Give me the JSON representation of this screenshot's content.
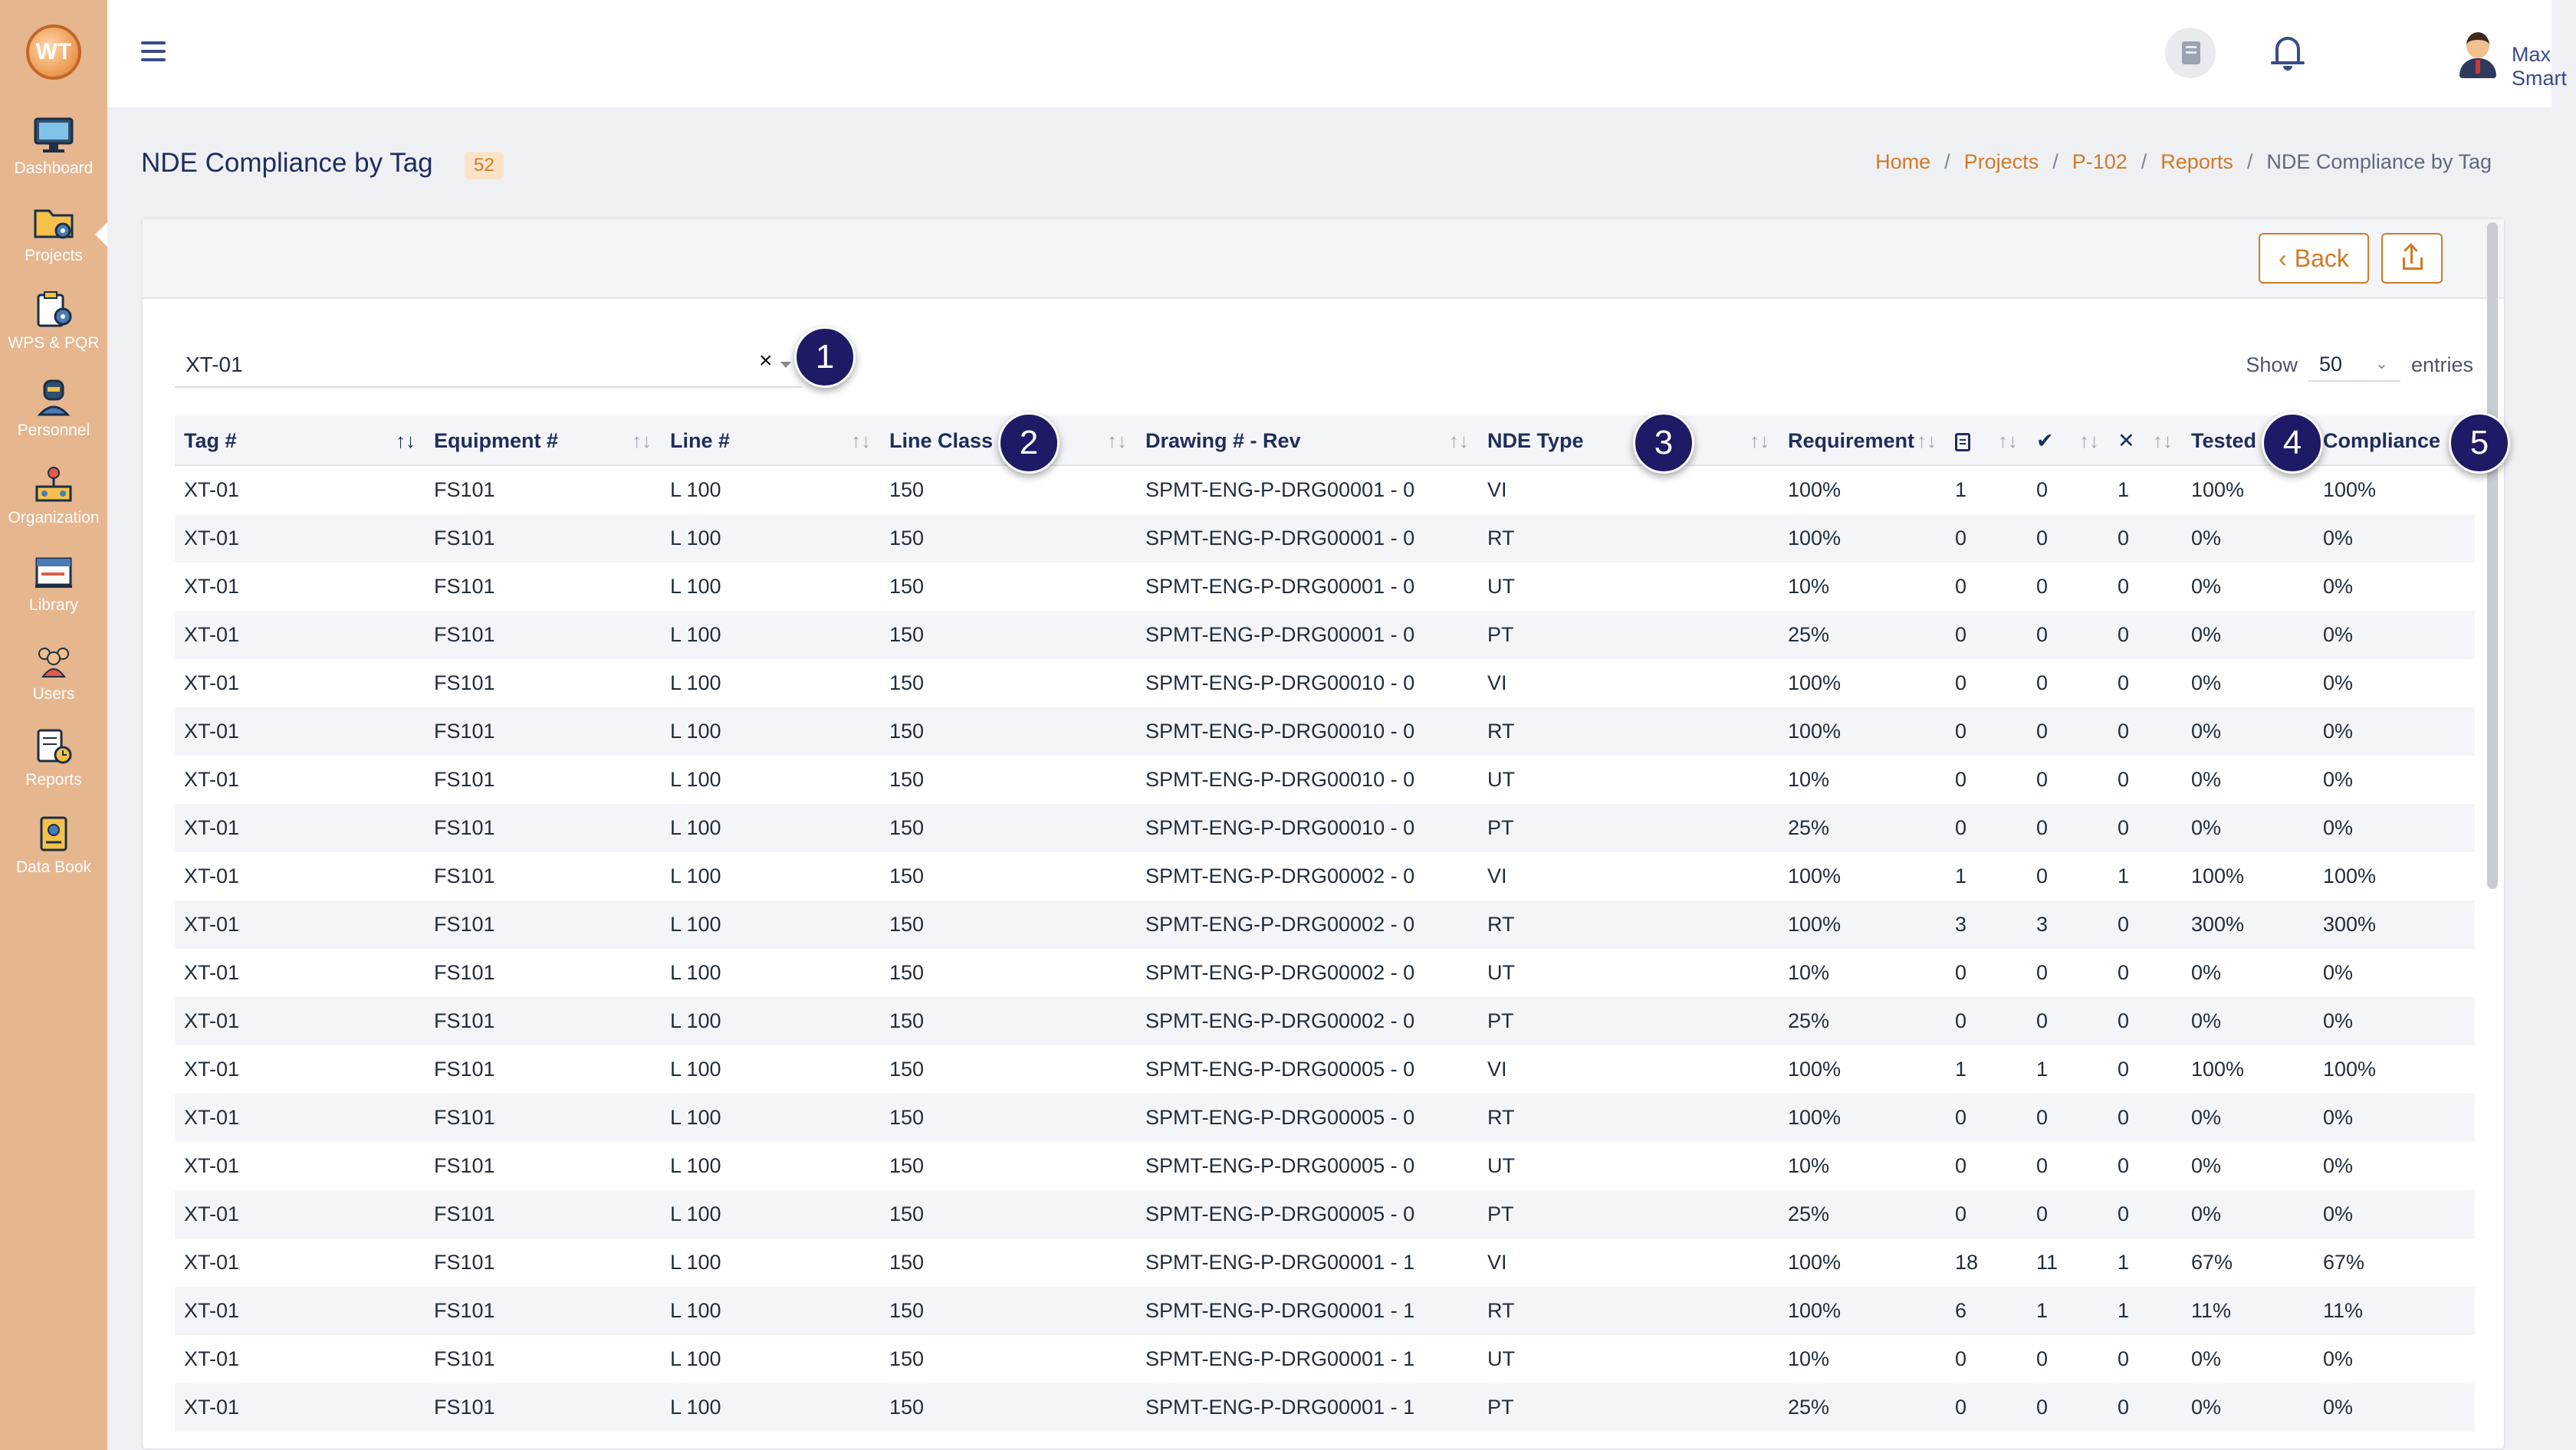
{
  "sidebar": {
    "logo_text": "WT",
    "items": [
      {
        "label": "Dashboard",
        "icon": "monitor-icon"
      },
      {
        "label": "Projects",
        "icon": "folder-gear-icon"
      },
      {
        "label": "WPS & PQR",
        "icon": "clipboard-gear-icon"
      },
      {
        "label": "Personnel",
        "icon": "welder-icon"
      },
      {
        "label": "Organization",
        "icon": "org-chart-icon"
      },
      {
        "label": "Library",
        "icon": "books-icon"
      },
      {
        "label": "Users",
        "icon": "users-icon"
      },
      {
        "label": "Reports",
        "icon": "report-clock-icon"
      },
      {
        "label": "Data Book",
        "icon": "data-book-icon"
      }
    ]
  },
  "header": {
    "user_name": "Max Smart"
  },
  "page": {
    "title": "NDE Compliance by Tag",
    "count": "52",
    "breadcrumb": [
      "Home",
      "Projects",
      "P-102",
      "Reports"
    ],
    "breadcrumb_current": "NDE Compliance by Tag"
  },
  "toolbar": {
    "back_label": "Back"
  },
  "filter": {
    "tag_value": "XT-01",
    "clear_symbol": "×",
    "show_label": "Show",
    "entries_value": "50",
    "entries_label": "entries"
  },
  "table": {
    "columns": {
      "tag": "Tag #",
      "equipment": "Equipment #",
      "line": "Line #",
      "line_class": "Line Class",
      "drawing": "Drawing # - Rev",
      "nde_type": "NDE Type",
      "requirement": "Requirement",
      "ok_symbol": "✔",
      "x_symbol": "✕",
      "tested": "Tested",
      "compliance": "Compliance"
    },
    "rows": [
      [
        "XT-01",
        "FS101",
        "L 100",
        "150",
        "SPMT-ENG-P-DRG00001 - 0",
        "VI",
        "100%",
        "1",
        "0",
        "1",
        "100%",
        "100%"
      ],
      [
        "XT-01",
        "FS101",
        "L 100",
        "150",
        "SPMT-ENG-P-DRG00001 - 0",
        "RT",
        "100%",
        "0",
        "0",
        "0",
        "0%",
        "0%"
      ],
      [
        "XT-01",
        "FS101",
        "L 100",
        "150",
        "SPMT-ENG-P-DRG00001 - 0",
        "UT",
        "10%",
        "0",
        "0",
        "0",
        "0%",
        "0%"
      ],
      [
        "XT-01",
        "FS101",
        "L 100",
        "150",
        "SPMT-ENG-P-DRG00001 - 0",
        "PT",
        "25%",
        "0",
        "0",
        "0",
        "0%",
        "0%"
      ],
      [
        "XT-01",
        "FS101",
        "L 100",
        "150",
        "SPMT-ENG-P-DRG00010 - 0",
        "VI",
        "100%",
        "0",
        "0",
        "0",
        "0%",
        "0%"
      ],
      [
        "XT-01",
        "FS101",
        "L 100",
        "150",
        "SPMT-ENG-P-DRG00010 - 0",
        "RT",
        "100%",
        "0",
        "0",
        "0",
        "0%",
        "0%"
      ],
      [
        "XT-01",
        "FS101",
        "L 100",
        "150",
        "SPMT-ENG-P-DRG00010 - 0",
        "UT",
        "10%",
        "0",
        "0",
        "0",
        "0%",
        "0%"
      ],
      [
        "XT-01",
        "FS101",
        "L 100",
        "150",
        "SPMT-ENG-P-DRG00010 - 0",
        "PT",
        "25%",
        "0",
        "0",
        "0",
        "0%",
        "0%"
      ],
      [
        "XT-01",
        "FS101",
        "L 100",
        "150",
        "SPMT-ENG-P-DRG00002 - 0",
        "VI",
        "100%",
        "1",
        "0",
        "1",
        "100%",
        "100%"
      ],
      [
        "XT-01",
        "FS101",
        "L 100",
        "150",
        "SPMT-ENG-P-DRG00002 - 0",
        "RT",
        "100%",
        "3",
        "3",
        "0",
        "300%",
        "300%"
      ],
      [
        "XT-01",
        "FS101",
        "L 100",
        "150",
        "SPMT-ENG-P-DRG00002 - 0",
        "UT",
        "10%",
        "0",
        "0",
        "0",
        "0%",
        "0%"
      ],
      [
        "XT-01",
        "FS101",
        "L 100",
        "150",
        "SPMT-ENG-P-DRG00002 - 0",
        "PT",
        "25%",
        "0",
        "0",
        "0",
        "0%",
        "0%"
      ],
      [
        "XT-01",
        "FS101",
        "L 100",
        "150",
        "SPMT-ENG-P-DRG00005 - 0",
        "VI",
        "100%",
        "1",
        "1",
        "0",
        "100%",
        "100%"
      ],
      [
        "XT-01",
        "FS101",
        "L 100",
        "150",
        "SPMT-ENG-P-DRG00005 - 0",
        "RT",
        "100%",
        "0",
        "0",
        "0",
        "0%",
        "0%"
      ],
      [
        "XT-01",
        "FS101",
        "L 100",
        "150",
        "SPMT-ENG-P-DRG00005 - 0",
        "UT",
        "10%",
        "0",
        "0",
        "0",
        "0%",
        "0%"
      ],
      [
        "XT-01",
        "FS101",
        "L 100",
        "150",
        "SPMT-ENG-P-DRG00005 - 0",
        "PT",
        "25%",
        "0",
        "0",
        "0",
        "0%",
        "0%"
      ],
      [
        "XT-01",
        "FS101",
        "L 100",
        "150",
        "SPMT-ENG-P-DRG00001 - 1",
        "VI",
        "100%",
        "18",
        "11",
        "1",
        "67%",
        "67%"
      ],
      [
        "XT-01",
        "FS101",
        "L 100",
        "150",
        "SPMT-ENG-P-DRG00001 - 1",
        "RT",
        "100%",
        "6",
        "1",
        "1",
        "11%",
        "11%"
      ],
      [
        "XT-01",
        "FS101",
        "L 100",
        "150",
        "SPMT-ENG-P-DRG00001 - 1",
        "UT",
        "10%",
        "0",
        "0",
        "0",
        "0%",
        "0%"
      ],
      [
        "XT-01",
        "FS101",
        "L 100",
        "150",
        "SPMT-ENG-P-DRG00001 - 1",
        "PT",
        "25%",
        "0",
        "0",
        "0",
        "0%",
        "0%"
      ]
    ]
  },
  "markers": [
    "1",
    "2",
    "3",
    "4",
    "5"
  ],
  "colors": {
    "accent": "#d07b26",
    "sidebar": "#e6b68f",
    "marker": "#1e1a66"
  }
}
